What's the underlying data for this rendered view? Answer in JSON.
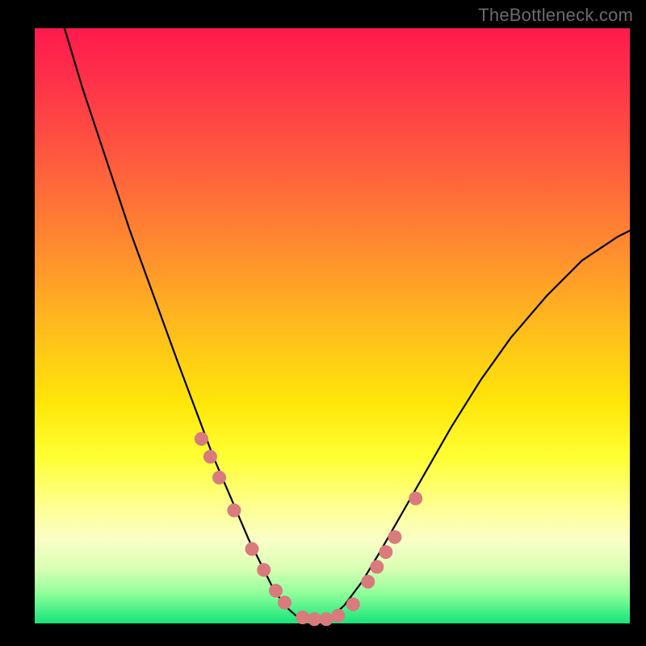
{
  "watermark": "TheBottleneck.com",
  "colors": {
    "curve": "#000000",
    "marker_fill": "#d97a7d",
    "marker_stroke": "#d97a7d"
  },
  "chart_data": {
    "type": "line",
    "title": "",
    "xlabel": "",
    "ylabel": "",
    "xlim": [
      0,
      100
    ],
    "ylim": [
      0,
      100
    ],
    "note": "No axes, ticks, or labels are rendered in the image; values are normalized 0–100 estimates read from the figure geometry.",
    "series": [
      {
        "name": "curve",
        "x": [
          5,
          8,
          12,
          16,
          20,
          24,
          27,
          30,
          33,
          36,
          38,
          40,
          42,
          44,
          46,
          48,
          50,
          52,
          55,
          58,
          62,
          66,
          70,
          75,
          80,
          86,
          92,
          98,
          100
        ],
        "y": [
          100,
          90,
          78,
          66,
          55,
          44,
          36,
          28,
          21,
          14,
          10,
          6,
          3,
          1.2,
          0.6,
          0.6,
          1.2,
          3,
          7,
          12,
          19,
          26,
          33,
          41,
          48,
          55,
          61,
          65,
          66
        ]
      }
    ],
    "markers": {
      "name": "highlighted-points",
      "color": "#d97a7d",
      "radius_px": 8,
      "x": [
        28,
        29.5,
        31,
        33.5,
        36.5,
        38.5,
        40.5,
        42,
        45,
        47,
        49,
        51,
        53.5,
        56,
        57.5,
        59,
        60.5,
        64
      ],
      "y": [
        31,
        28,
        24.5,
        19,
        12.5,
        9,
        5.5,
        3.5,
        1,
        0.7,
        0.7,
        1.3,
        3.2,
        7,
        9.5,
        12,
        14.5,
        21
      ]
    }
  }
}
